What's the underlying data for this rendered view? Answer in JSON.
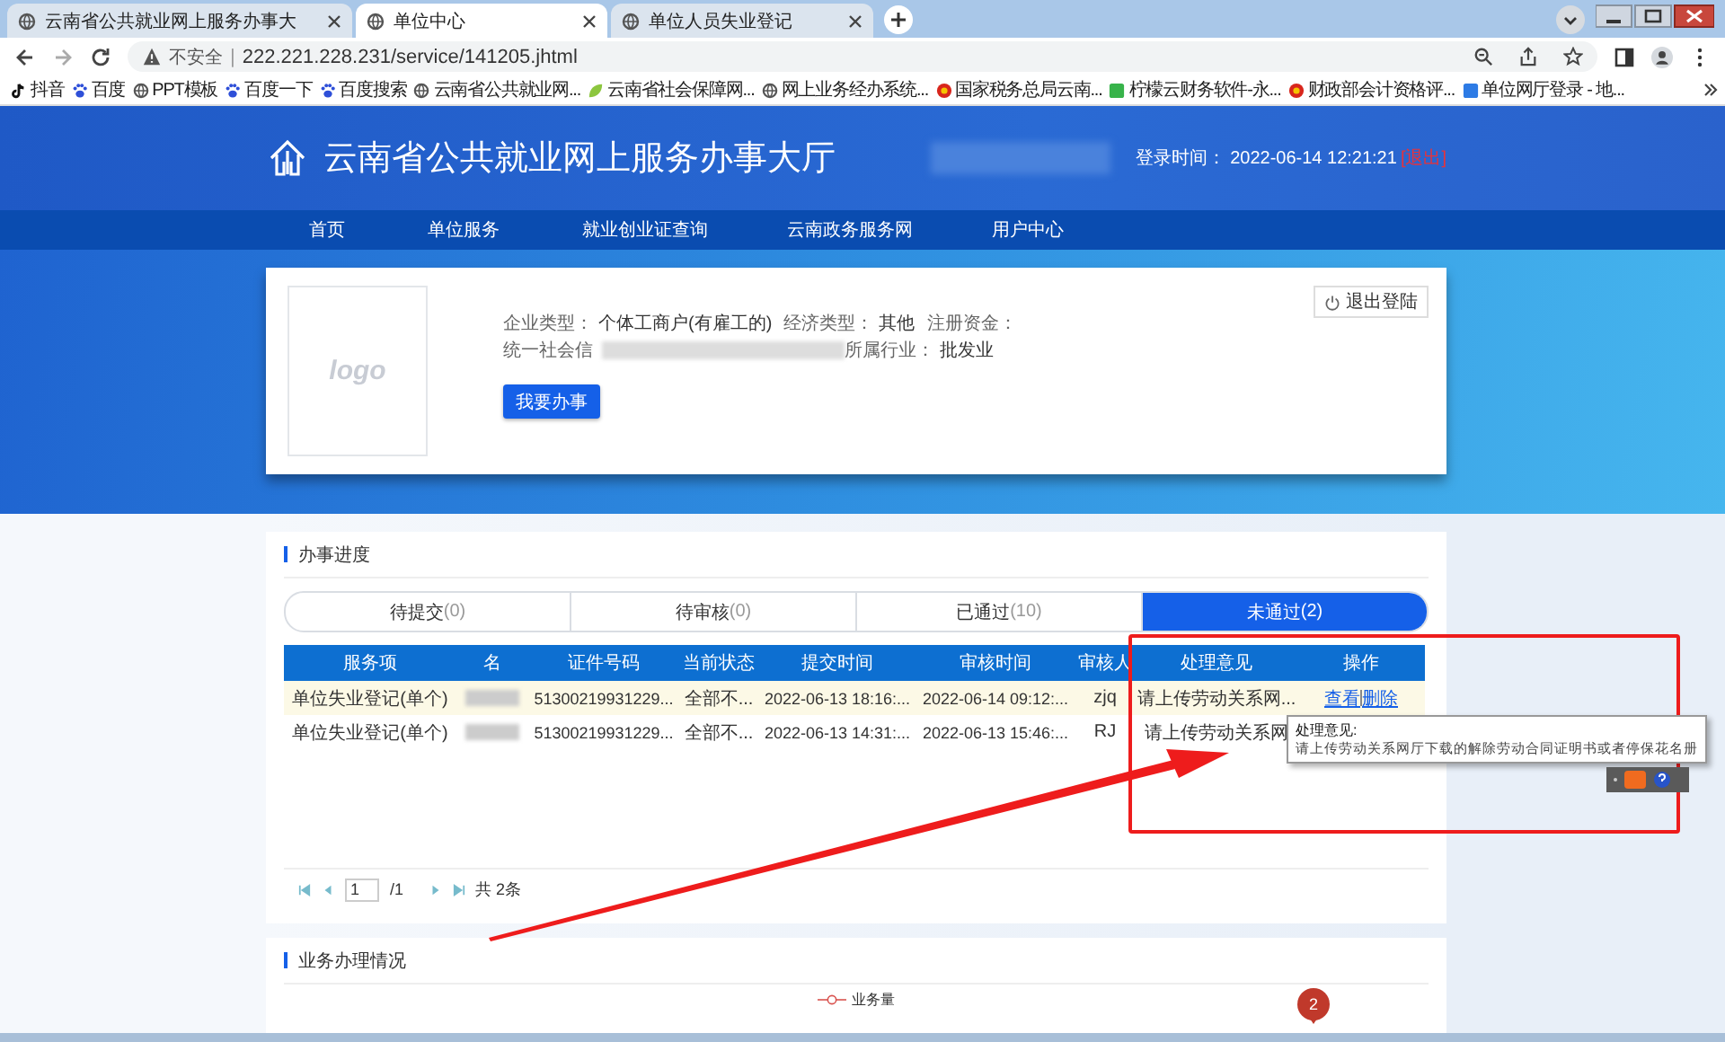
{
  "browser": {
    "tabs": [
      {
        "title": "云南省公共就业网上服务办事大",
        "selected": false
      },
      {
        "title": "单位中心",
        "selected": true
      },
      {
        "title": "单位人员失业登记",
        "selected": false
      }
    ],
    "security": "不安全",
    "separator": "|",
    "url": "222.221.228.231/service/141205.jhtml",
    "bookmarks": [
      {
        "label": "抖音",
        "kind": "note"
      },
      {
        "label": "百度",
        "kind": "paw"
      },
      {
        "label": "PPT模板",
        "kind": "globe"
      },
      {
        "label": "百度一下",
        "kind": "paw"
      },
      {
        "label": "百度搜索",
        "kind": "paw"
      },
      {
        "label": "云南省公共就业网...",
        "kind": "globe"
      },
      {
        "label": "云南省社会保障网...",
        "kind": "leaf"
      },
      {
        "label": "网上业务经办系统...",
        "kind": "globe"
      },
      {
        "label": "国家税务总局云南...",
        "kind": "emblem"
      },
      {
        "label": "柠檬云财务软件-永...",
        "kind": "lemon"
      },
      {
        "label": "财政部会计资格评...",
        "kind": "emblem"
      },
      {
        "label": "单位网厅登录 - 地...",
        "kind": "tile"
      }
    ]
  },
  "header": {
    "title": "云南省公共就业网上服务办事大厅",
    "login_label": "登录时间：",
    "login_time": "2022-06-14 12:21:21",
    "logout": "[退出]"
  },
  "nav": [
    "首页",
    "单位服务",
    "就业创业证查询",
    "云南政务服务网",
    "用户中心"
  ],
  "profile": {
    "logo": "logo",
    "rows": [
      [
        {
          "label": "企业类型：",
          "value": "个体工商户(有雇工的)"
        },
        {
          "label": "经济类型：",
          "value": "其他"
        },
        {
          "label": "注册资金："
        }
      ],
      [
        {
          "label": "统一社会信"
        },
        {
          "label": "所属行业：",
          "value": "批发业"
        }
      ]
    ],
    "logout_button": "退出登陆",
    "action_button": "我要办事"
  },
  "progress": {
    "title": "办事进度",
    "tabs": [
      {
        "label": "待提交",
        "count": "(0)",
        "selected": false
      },
      {
        "label": "待审核",
        "count": "(0)",
        "selected": false
      },
      {
        "label": "已通过",
        "count": "(10)",
        "selected": false
      },
      {
        "label": "未通过",
        "count": "(2)",
        "selected": true
      }
    ],
    "columns": [
      "服务项",
      "名",
      "证件号码",
      "当前状态",
      "提交时间",
      "审核时间",
      "审核人",
      "处理意见",
      "操作"
    ],
    "rows": [
      {
        "hovered": true,
        "service": "单位失业登记(单个)",
        "id": "51300219931229...",
        "status": "全部不...",
        "submitted": "2022-06-13 18:16:...",
        "reviewed": "2022-06-14 09:12:...",
        "reviewer": "zjq",
        "opinion": "请上传劳动关系网...",
        "actions": [
          "查看",
          "删除"
        ]
      },
      {
        "hovered": false,
        "service": "单位失业登记(单个)",
        "id": "51300219931229...",
        "status": "全部不...",
        "submitted": "2022-06-13 14:31:...",
        "reviewed": "2022-06-13 15:46:...",
        "reviewer": "RJ",
        "opinion": "请上传劳动关系网"
      }
    ],
    "pager": {
      "page": "1",
      "total": "/1",
      "count": "共 2条"
    },
    "tooltip": {
      "title": "处理意见:",
      "text": "请上传劳动关系网厅下载的解除劳动合同证明书或者停保花名册"
    }
  },
  "stats": {
    "title": "业务办理情况",
    "legend": "业务量"
  },
  "marker": "2"
}
